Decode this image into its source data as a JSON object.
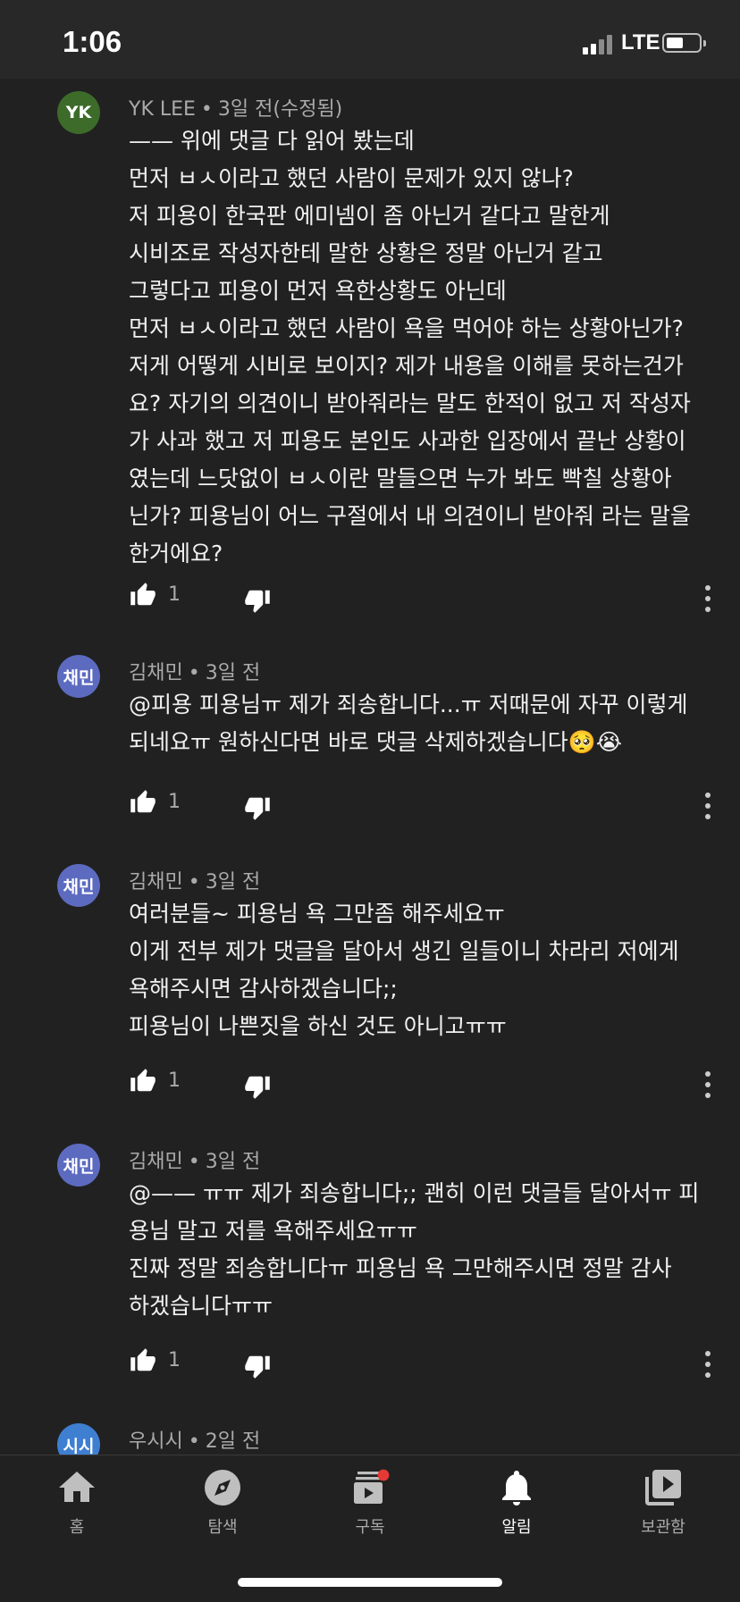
{
  "status_bar": {
    "time": "1:06",
    "network": "LTE"
  },
  "comments": [
    {
      "avatar_text": "YK",
      "avatar_color": "#3d6b2a",
      "author": "YK LEE",
      "time": "3일 전(수정됨)",
      "text": "—— 위에 댓글 다 읽어 봤는데\n먼저 ㅂㅅ이라고 했던 사람이 문제가 있지 않나?\n저 피용이 한국판 에미넴이 좀 아닌거 같다고 말한게\n시비조로 작성자한테 말한 상황은 정말 아닌거 같고\n그렇다고 피용이 먼저 욕한상황도 아닌데\n먼저 ㅂㅅ이라고 했던 사람이 욕을 먹어야 하는 상황아닌가?\n저게 어떻게 시비로 보이지? 제가 내용을 이해를 못하는건가\n요? 자기의 의견이니 받아줘라는 말도 한적이 없고 저 작성자\n가 사과 했고 저 피용도 본인도 사과한 입장에서 끝난 상황이\n였는데 느닷없이 ㅂㅅ이란 말들으면 누가 봐도 빡칠 상황아\n닌가? 피용님이 어느 구절에서 내 의견이니 받아줘 라는 말을\n한거에요?",
      "likes": "1"
    },
    {
      "avatar_text": "채민",
      "avatar_color": "#5c6bc0",
      "author": "김채민",
      "time": "3일 전",
      "text": "@피용 피용님ㅠ 제가 죄송합니다...ㅠ 저때문에 자꾸 이렇게\n되네요ㅠ 원하신다면 바로 댓글 삭제하겠습니다🥺😭",
      "likes": "1"
    },
    {
      "avatar_text": "채민",
      "avatar_color": "#5c6bc0",
      "author": "김채민",
      "time": "3일 전",
      "text": "여러분들~ 피용님 욕 그만좀 해주세요ㅠ\n이게 전부 제가 댓글을 달아서 생긴 일들이니 차라리 저에게\n욕해주시면 감사하겠습니다;;\n피용님이 나쁜짓을 하신 것도 아니고ㅠㅠ",
      "likes": "1"
    },
    {
      "avatar_text": "채민",
      "avatar_color": "#5c6bc0",
      "author": "김채민",
      "time": "3일 전",
      "text": "@—— ㅠㅠ 제가 죄송합니다;; 괜히 이런 댓글들 달아서ㅠ 피\n용님 말고 저를 욕해주세요ㅠㅠ\n진짜 정말 죄송합니다ㅠ 피용님 욕 그만해주시면 정말 감사\n하겠습니다ㅠㅠ",
      "likes": "1"
    },
    {
      "avatar_text": "시시",
      "avatar_color": "#3f7fd1",
      "author": "우시시",
      "time": "2일 전",
      "text": "",
      "likes": ""
    }
  ],
  "nav": {
    "home": "홈",
    "explore": "탐색",
    "subscriptions": "구독",
    "notifications": "알림",
    "library": "보관함"
  },
  "icons": {
    "like": "thumb-up-icon",
    "dislike": "thumb-down-icon",
    "more": "more-vert-icon"
  }
}
